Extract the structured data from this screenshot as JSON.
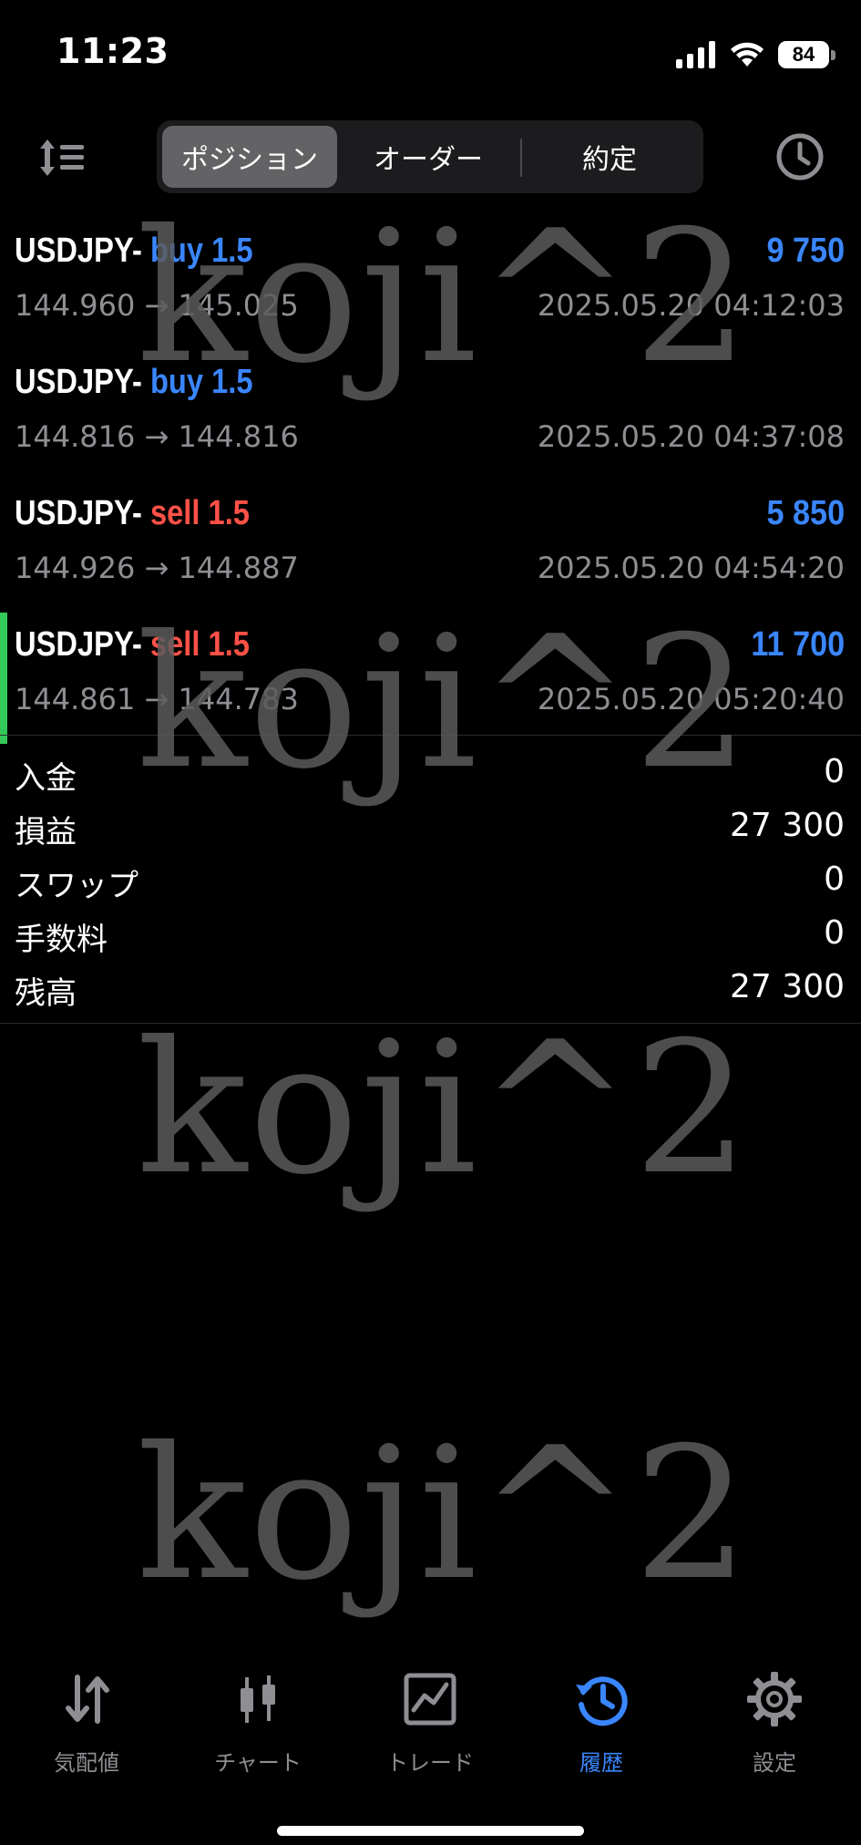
{
  "status_bar": {
    "time": "11:23",
    "battery": "84"
  },
  "segment_tabs": [
    {
      "label": "ポジション",
      "selected": true
    },
    {
      "label": "オーダー",
      "selected": false
    },
    {
      "label": "約定",
      "selected": false
    }
  ],
  "trades": [
    {
      "symbol": "USDJPY-",
      "side": "buy",
      "volume": "1.5",
      "open_price": "144.960",
      "arrow": "→",
      "close_price": "145.025",
      "time": "2025.05.20 04:12:03",
      "profit": "9 750"
    },
    {
      "symbol": "USDJPY-",
      "side": "buy",
      "volume": "1.5",
      "open_price": "144.816",
      "arrow": "→",
      "close_price": "144.816",
      "time": "2025.05.20 04:37:08",
      "profit": ""
    },
    {
      "symbol": "USDJPY-",
      "side": "sell",
      "volume": "1.5",
      "open_price": "144.926",
      "arrow": "→",
      "close_price": "144.887",
      "time": "2025.05.20 04:54:20",
      "profit": "5 850"
    },
    {
      "symbol": "USDJPY-",
      "side": "sell",
      "volume": "1.5",
      "open_price": "144.861",
      "arrow": "→",
      "close_price": "144.783",
      "time": "2025.05.20 05:20:40",
      "profit": "11 700"
    }
  ],
  "summary": [
    {
      "label": "入金",
      "value": "0"
    },
    {
      "label": "損益",
      "value": "27 300"
    },
    {
      "label": "スワップ",
      "value": "0"
    },
    {
      "label": "手数料",
      "value": "0"
    },
    {
      "label": "残高",
      "value": "27 300"
    }
  ],
  "watermark": {
    "text": "koji^2"
  },
  "tab_bar": [
    {
      "label": "気配値",
      "icon": "quotes-arrows-icon",
      "active": false
    },
    {
      "label": "チャート",
      "icon": "candlestick-chart-icon",
      "active": false
    },
    {
      "label": "トレード",
      "icon": "trade-chart-icon",
      "active": false
    },
    {
      "label": "履歴",
      "icon": "history-clock-icon",
      "active": true
    },
    {
      "label": "設定",
      "icon": "settings-gear-icon",
      "active": false
    }
  ],
  "colors": {
    "buy": "#3a86ff",
    "sell": "#ff5147",
    "profit": "#3a86ff",
    "selected_bar": "#34c759",
    "active_tab": "#3a86ff"
  }
}
